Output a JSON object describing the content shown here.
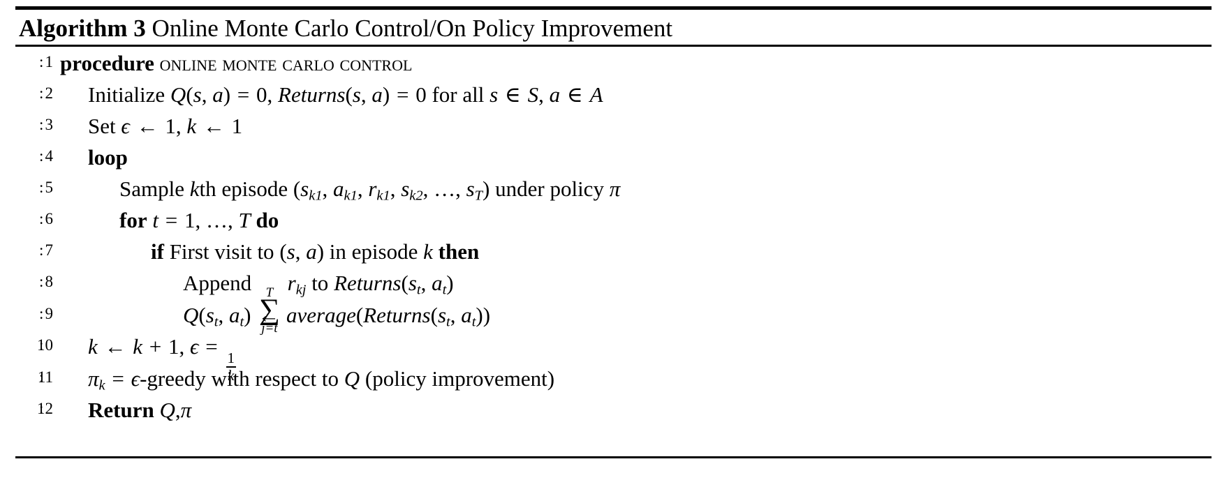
{
  "algorithm": {
    "label": "Algorithm",
    "number": "3",
    "name": "Online Monte Carlo Control/On Policy Improvement",
    "procedure_keyword": "procedure",
    "procedure_name": "Online Monte Carlo Control",
    "lines": [
      {
        "no": "1",
        "indent": 0,
        "text": "procedure Online Monte Carlo Control"
      },
      {
        "no": "2",
        "indent": 1,
        "text": "Initialize Q(s, a) = 0, Returns(s, a) = 0 for all s ∈ S, a ∈ A"
      },
      {
        "no": "3",
        "indent": 1,
        "text": "Set ϵ ← 1, k ← 1"
      },
      {
        "no": "4",
        "indent": 1,
        "text": "loop"
      },
      {
        "no": "5",
        "indent": 2,
        "text": "Sample kth episode (sₖ₁, aₖ₁, rₖ₁, sₖ₂, …, sₜ) under policy π"
      },
      {
        "no": "6",
        "indent": 2,
        "text": "for t = 1, …, T do"
      },
      {
        "no": "7",
        "indent": 3,
        "text": "if First visit to (s, a) in episode k then"
      },
      {
        "no": "8",
        "indent": 4,
        "text": "Append ∑ⱼ₌ₜᵀ rₖⱼ to Returns(sₜ, aₜ)"
      },
      {
        "no": "9",
        "indent": 4,
        "text": "Q(sₜ, aₜ) ← average(Returns(sₜ, aₜ))"
      },
      {
        "no": "10",
        "indent": 1,
        "text": "k ← k + 1, ϵ = 1/k"
      },
      {
        "no": "11",
        "indent": 1,
        "text": "πₖ = ϵ-greedy with respect to Q (policy improvement)"
      },
      {
        "no": "12",
        "indent": 0,
        "text": "Return Q, π"
      }
    ],
    "tokens": {
      "procedure": "procedure",
      "proc_name": "Online Monte Carlo Control",
      "initialize": "Initialize",
      "Q": "Q",
      "s": "s",
      "a": "a",
      "comma": ",",
      "eq": "=",
      "zero": "0",
      "Returns": "Returns",
      "for_all": "for all",
      "in": "∈",
      "S": "S",
      "A": "A",
      "set": "Set",
      "epsilon": "ϵ",
      "gets": "←",
      "one": "1",
      "k": "k",
      "loop": "loop",
      "sample": "Sample",
      "kth": "k",
      "th": "th",
      "episode": "episode",
      "r": "r",
      "dots": "…",
      "T": "T",
      "under_policy": "under policy",
      "pi": "π",
      "for": "for",
      "t": "t",
      "do": "do",
      "if": "if",
      "first_visit_to": "First visit to",
      "in_episode": "in episode",
      "then": "then",
      "append": "Append",
      "sum": "∑",
      "sum_lower": "j=t",
      "sum_upper": "T",
      "j": "j",
      "to": "to",
      "average": "average",
      "plus": "+",
      "greedy": "-greedy with respect to",
      "policy_improvement": "(policy improvement)",
      "return": "Return",
      "lparen": "(",
      "rparen": ")"
    },
    "colors": {
      "ink": "#000000",
      "paper": "#ffffff"
    }
  }
}
